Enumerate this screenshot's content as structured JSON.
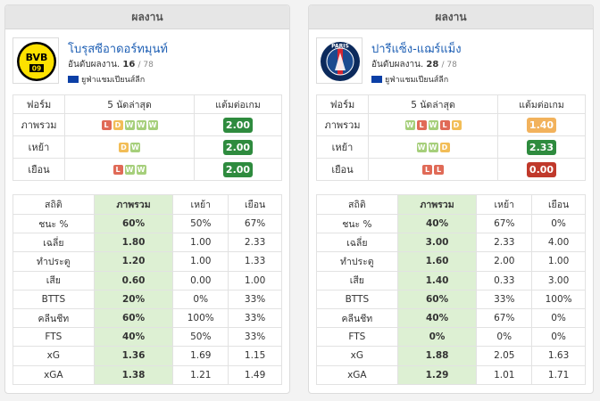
{
  "panels": [
    {
      "header": "ผลงาน",
      "team": {
        "name": "โบรุสซีอาดอร์ทมุนท์",
        "rank_label": "อันดับผลงาน.",
        "rank": "16",
        "rank_total": "/ 78",
        "league": "ยูฟ่าแชมเปียนส์ลีก",
        "logo_text": "BVB",
        "logo_sub": "09"
      },
      "form": {
        "headers": [
          "ฟอร์ม",
          "5 นัดล่าสุด",
          "แต้มต่อเกม"
        ],
        "rows": [
          {
            "label": "ภาพรวม",
            "results": [
              "L",
              "D",
              "W",
              "W",
              "W"
            ],
            "ppg": "2.00",
            "ppg_level": "good"
          },
          {
            "label": "เหย้า",
            "results": [
              "D",
              "W"
            ],
            "ppg": "2.00",
            "ppg_level": "good"
          },
          {
            "label": "เยือน",
            "results": [
              "L",
              "W",
              "W"
            ],
            "ppg": "2.00",
            "ppg_level": "good"
          }
        ]
      },
      "stats": {
        "headers": [
          "สถิติ",
          "ภาพรวม",
          "เหย้า",
          "เยือน"
        ],
        "rows": [
          [
            "ชนะ %",
            "60%",
            "50%",
            "67%"
          ],
          [
            "เฉลี่ย",
            "1.80",
            "1.00",
            "2.33"
          ],
          [
            "ทำประตู",
            "1.20",
            "1.00",
            "1.33"
          ],
          [
            "เสีย",
            "0.60",
            "0.00",
            "1.00"
          ],
          [
            "BTTS",
            "20%",
            "0%",
            "33%"
          ],
          [
            "คลีนชีท",
            "60%",
            "100%",
            "33%"
          ],
          [
            "FTS",
            "40%",
            "50%",
            "33%"
          ],
          [
            "xG",
            "1.36",
            "1.69",
            "1.15"
          ],
          [
            "xGA",
            "1.38",
            "1.21",
            "1.49"
          ]
        ]
      }
    },
    {
      "header": "ผลงาน",
      "team": {
        "name": "ปารีแซ็ง-แฌร์แม็ง",
        "rank_label": "อันดับผลงาน.",
        "rank": "28",
        "rank_total": "/ 78",
        "league": "ยูฟ่าแชมเปียนส์ลีก",
        "logo_text": "PARIS",
        "logo_sub": ""
      },
      "form": {
        "headers": [
          "ฟอร์ม",
          "5 นัดล่าสุด",
          "แต้มต่อเกม"
        ],
        "rows": [
          {
            "label": "ภาพรวม",
            "results": [
              "W",
              "L",
              "W",
              "L",
              "D"
            ],
            "ppg": "1.40",
            "ppg_level": "mid"
          },
          {
            "label": "เหย้า",
            "results": [
              "W",
              "W",
              "D"
            ],
            "ppg": "2.33",
            "ppg_level": "good"
          },
          {
            "label": "เยือน",
            "results": [
              "L",
              "L"
            ],
            "ppg": "0.00",
            "ppg_level": "bad"
          }
        ]
      },
      "stats": {
        "headers": [
          "สถิติ",
          "ภาพรวม",
          "เหย้า",
          "เยือน"
        ],
        "rows": [
          [
            "ชนะ %",
            "40%",
            "67%",
            "0%"
          ],
          [
            "เฉลี่ย",
            "3.00",
            "2.33",
            "4.00"
          ],
          [
            "ทำประตู",
            "1.60",
            "2.00",
            "1.00"
          ],
          [
            "เสีย",
            "1.40",
            "0.33",
            "3.00"
          ],
          [
            "BTTS",
            "60%",
            "33%",
            "100%"
          ],
          [
            "คลีนชีท",
            "40%",
            "67%",
            "0%"
          ],
          [
            "FTS",
            "0%",
            "0%",
            "0%"
          ],
          [
            "xG",
            "1.88",
            "2.05",
            "1.63"
          ],
          [
            "xGA",
            "1.29",
            "1.01",
            "1.71"
          ]
        ]
      }
    }
  ]
}
